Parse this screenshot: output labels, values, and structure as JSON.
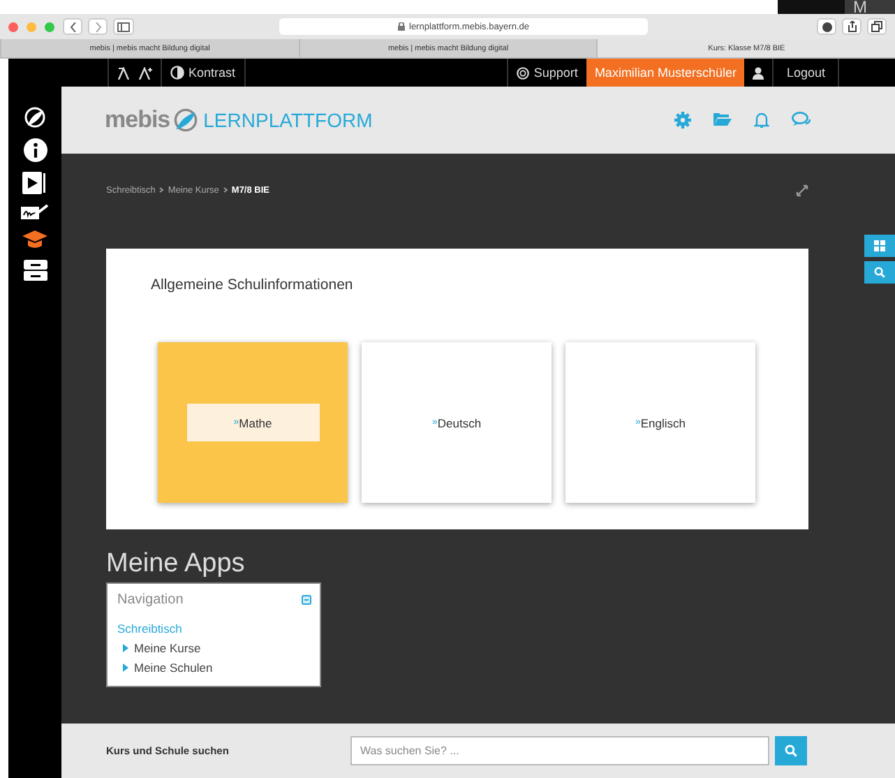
{
  "corner": {
    "text": "M"
  },
  "browser": {
    "url": "lernplattform.mebis.bayern.de",
    "tabs": [
      {
        "title": "mebis | mebis macht Bildung digital",
        "selected": false
      },
      {
        "title": "mebis | mebis macht Bildung digital",
        "selected": false
      },
      {
        "title": "Kurs: Klasse M7/8 BIE",
        "selected": true
      }
    ]
  },
  "topbar": {
    "contrast": "Kontrast",
    "support": "Support",
    "user": "Maximilian Musterschüler",
    "logout": "Logout"
  },
  "sidebar": {
    "items": [
      {
        "kind": "leaf",
        "selected": false
      },
      {
        "kind": "info",
        "selected": false
      },
      {
        "kind": "video",
        "selected": false
      },
      {
        "kind": "sign",
        "selected": false
      },
      {
        "kind": "cap",
        "selected": true
      },
      {
        "kind": "archive",
        "selected": false
      }
    ]
  },
  "header": {
    "brand": "mebis",
    "product": "LERNPLATTFORM"
  },
  "breadcrumbs": [
    {
      "label": "Schreibtisch",
      "current": false
    },
    {
      "label": "Meine Kurse",
      "current": false
    },
    {
      "label": "M7/8 BIE",
      "current": true
    }
  ],
  "card": {
    "title": "Allgemeine Schulinformationen",
    "tiles": [
      {
        "marker": "»",
        "label": "Mathe",
        "highlighted": true
      },
      {
        "marker": "»",
        "label": "Deutsch",
        "highlighted": false
      },
      {
        "marker": "»",
        "label": "Englisch",
        "highlighted": false
      }
    ]
  },
  "apps": {
    "title": "Meine Apps",
    "block_title": "Navigation",
    "root": "Schreibtisch",
    "children": [
      {
        "label": "Meine Kurse"
      },
      {
        "label": "Meine Schulen"
      }
    ]
  },
  "footer": {
    "label": "Kurs und Schule suchen",
    "placeholder": "Was suchen Sie? ..."
  }
}
